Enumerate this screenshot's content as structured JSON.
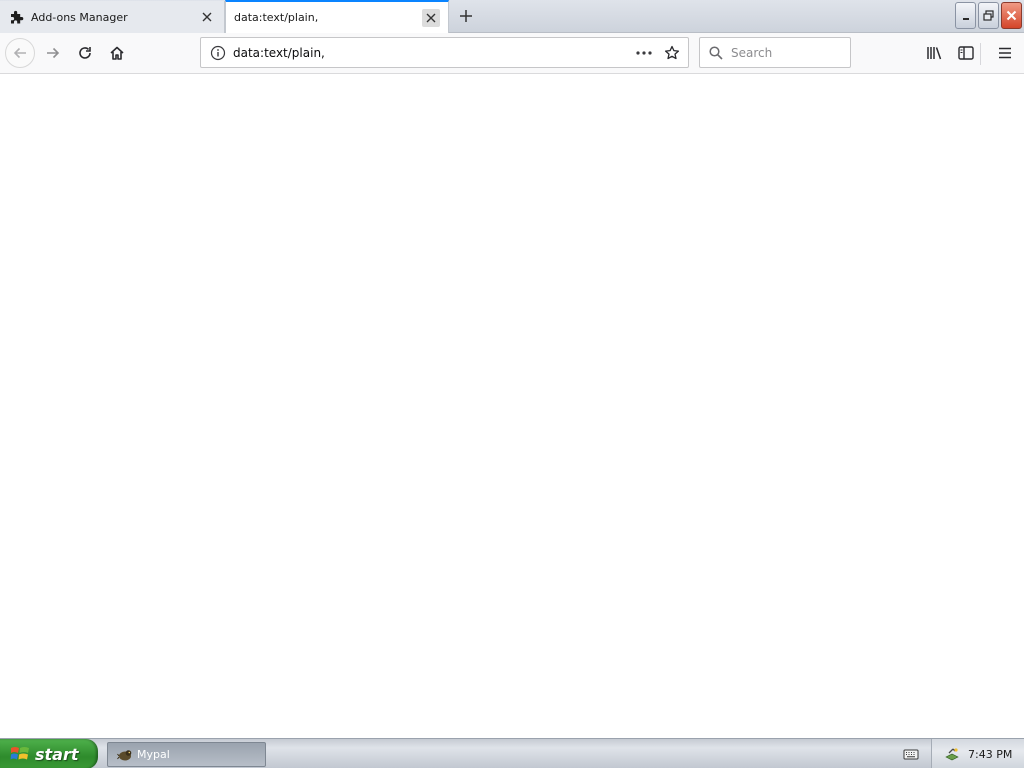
{
  "tabs": [
    {
      "label": "Add-ons Manager",
      "icon": "puzzle-icon",
      "active": false
    },
    {
      "label": "data:text/plain,",
      "icon": "none",
      "active": true
    }
  ],
  "navbar": {
    "url": "data:text/plain,",
    "search_placeholder": "Search"
  },
  "taskbar": {
    "start_label": "start",
    "items": [
      {
        "label": "Mypal",
        "icon": "mypal-app-icon"
      }
    ],
    "clock": "7:43 PM"
  },
  "colors": {
    "active_tab_accent": "#0a84ff",
    "start_green": "#3a9a36",
    "close_red": "#d4452a"
  }
}
